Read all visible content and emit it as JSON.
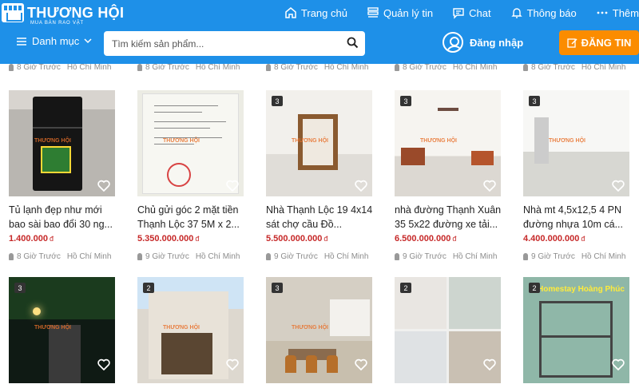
{
  "brand": {
    "name": "THƯƠNG HỘI",
    "tagline": "MUA BÁN RAO VẶT"
  },
  "nav": {
    "home": "Trang chủ",
    "manage": "Quản lý tin",
    "chat": "Chat",
    "notify": "Thông báo",
    "more": "Thêm"
  },
  "category": {
    "label": "Danh mục"
  },
  "search": {
    "placeholder": "Tìm kiếm sản phẩm..."
  },
  "login": {
    "label": "Đăng nhập"
  },
  "post": {
    "label": "ĐĂNG TIN"
  },
  "currency": "đ",
  "top_row": [
    {
      "time": "8 Giờ Trước",
      "loc": "Hồ Chí Minh"
    },
    {
      "time": "8 Giờ Trước",
      "loc": "Hồ Chí Minh"
    },
    {
      "time": "8 Giờ Trước",
      "loc": "Hồ Chí Minh"
    },
    {
      "time": "8 Giờ Trước",
      "loc": "Hồ Chí Minh"
    },
    {
      "time": "8 Giờ Trước",
      "loc": "Hồ Chí Minh"
    }
  ],
  "listings": [
    {
      "title": "Tủ lạnh đẹp như mới bao sài bao đổi 30 ng...",
      "price": "1.400.000",
      "time": "8 Giờ Trước",
      "loc": "Hồ Chí Minh",
      "count": ""
    },
    {
      "title": "Chủ gửi góc 2 mặt tiền Thạnh Lộc 37 5M x 2...",
      "price": "5.350.000.000",
      "time": "9 Giờ Trước",
      "loc": "Hồ Chí Minh",
      "count": ""
    },
    {
      "title": "Nhà Thạnh Lộc 19 4x14 sát chợ cầu Đồ...",
      "price": "5.500.000.000",
      "time": "9 Giờ Trước",
      "loc": "Hồ Chí Minh",
      "count": "3"
    },
    {
      "title": "nhà đường Thạnh Xuân 35 5x22 đường xe tải...",
      "price": "6.500.000.000",
      "time": "9 Giờ Trước",
      "loc": "Hồ Chí Minh",
      "count": "3"
    },
    {
      "title": "Nhà mt 4,5x12,5 4 PN đường nhựa 10m cá...",
      "price": "4.400.000.000",
      "time": "9 Giờ Trước",
      "loc": "Hồ Chí Minh",
      "count": "3"
    }
  ],
  "bottom_row": [
    {
      "count": "3"
    },
    {
      "count": "2"
    },
    {
      "count": "3"
    },
    {
      "count": "2"
    },
    {
      "count": "2",
      "overlay_text": "Homestay Hoàng Phúc"
    }
  ],
  "watermark": "THƯƠNG HỘI"
}
